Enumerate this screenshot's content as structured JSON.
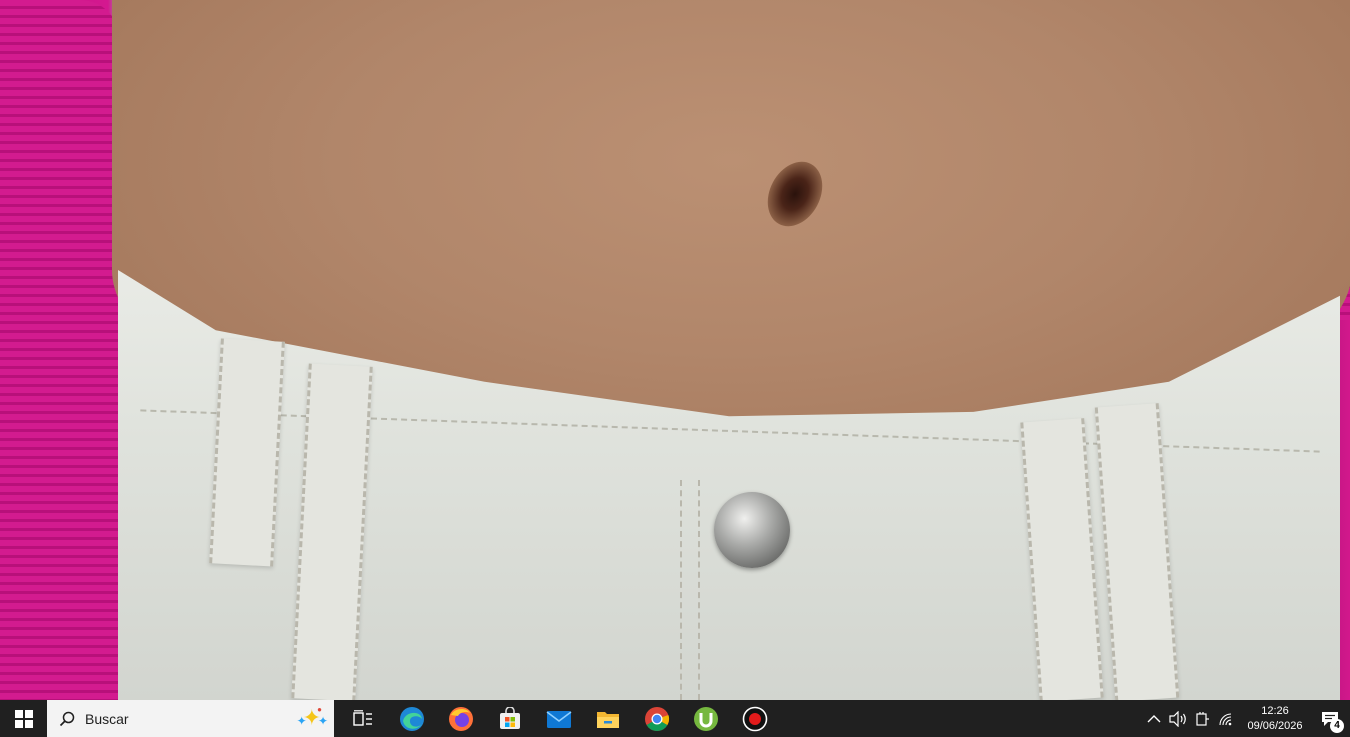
{
  "photo": {
    "description_icon": "photo-content"
  },
  "taskbar": {
    "search": {
      "placeholder": "Buscar"
    },
    "apps": [
      {
        "name": "task-view-icon"
      },
      {
        "name": "edge-icon"
      },
      {
        "name": "firefox-icon"
      },
      {
        "name": "microsoft-store-icon"
      },
      {
        "name": "mail-icon"
      },
      {
        "name": "file-explorer-icon"
      },
      {
        "name": "chrome-icon"
      },
      {
        "name": "utorrent-icon"
      },
      {
        "name": "screen-recorder-icon"
      }
    ],
    "clock": {
      "time": "12:26",
      "date": "09/06/2026"
    },
    "notifications": {
      "count": "4"
    },
    "colors": {
      "taskbar_bg": "#202020",
      "search_bg": "#f3f3f3"
    }
  }
}
